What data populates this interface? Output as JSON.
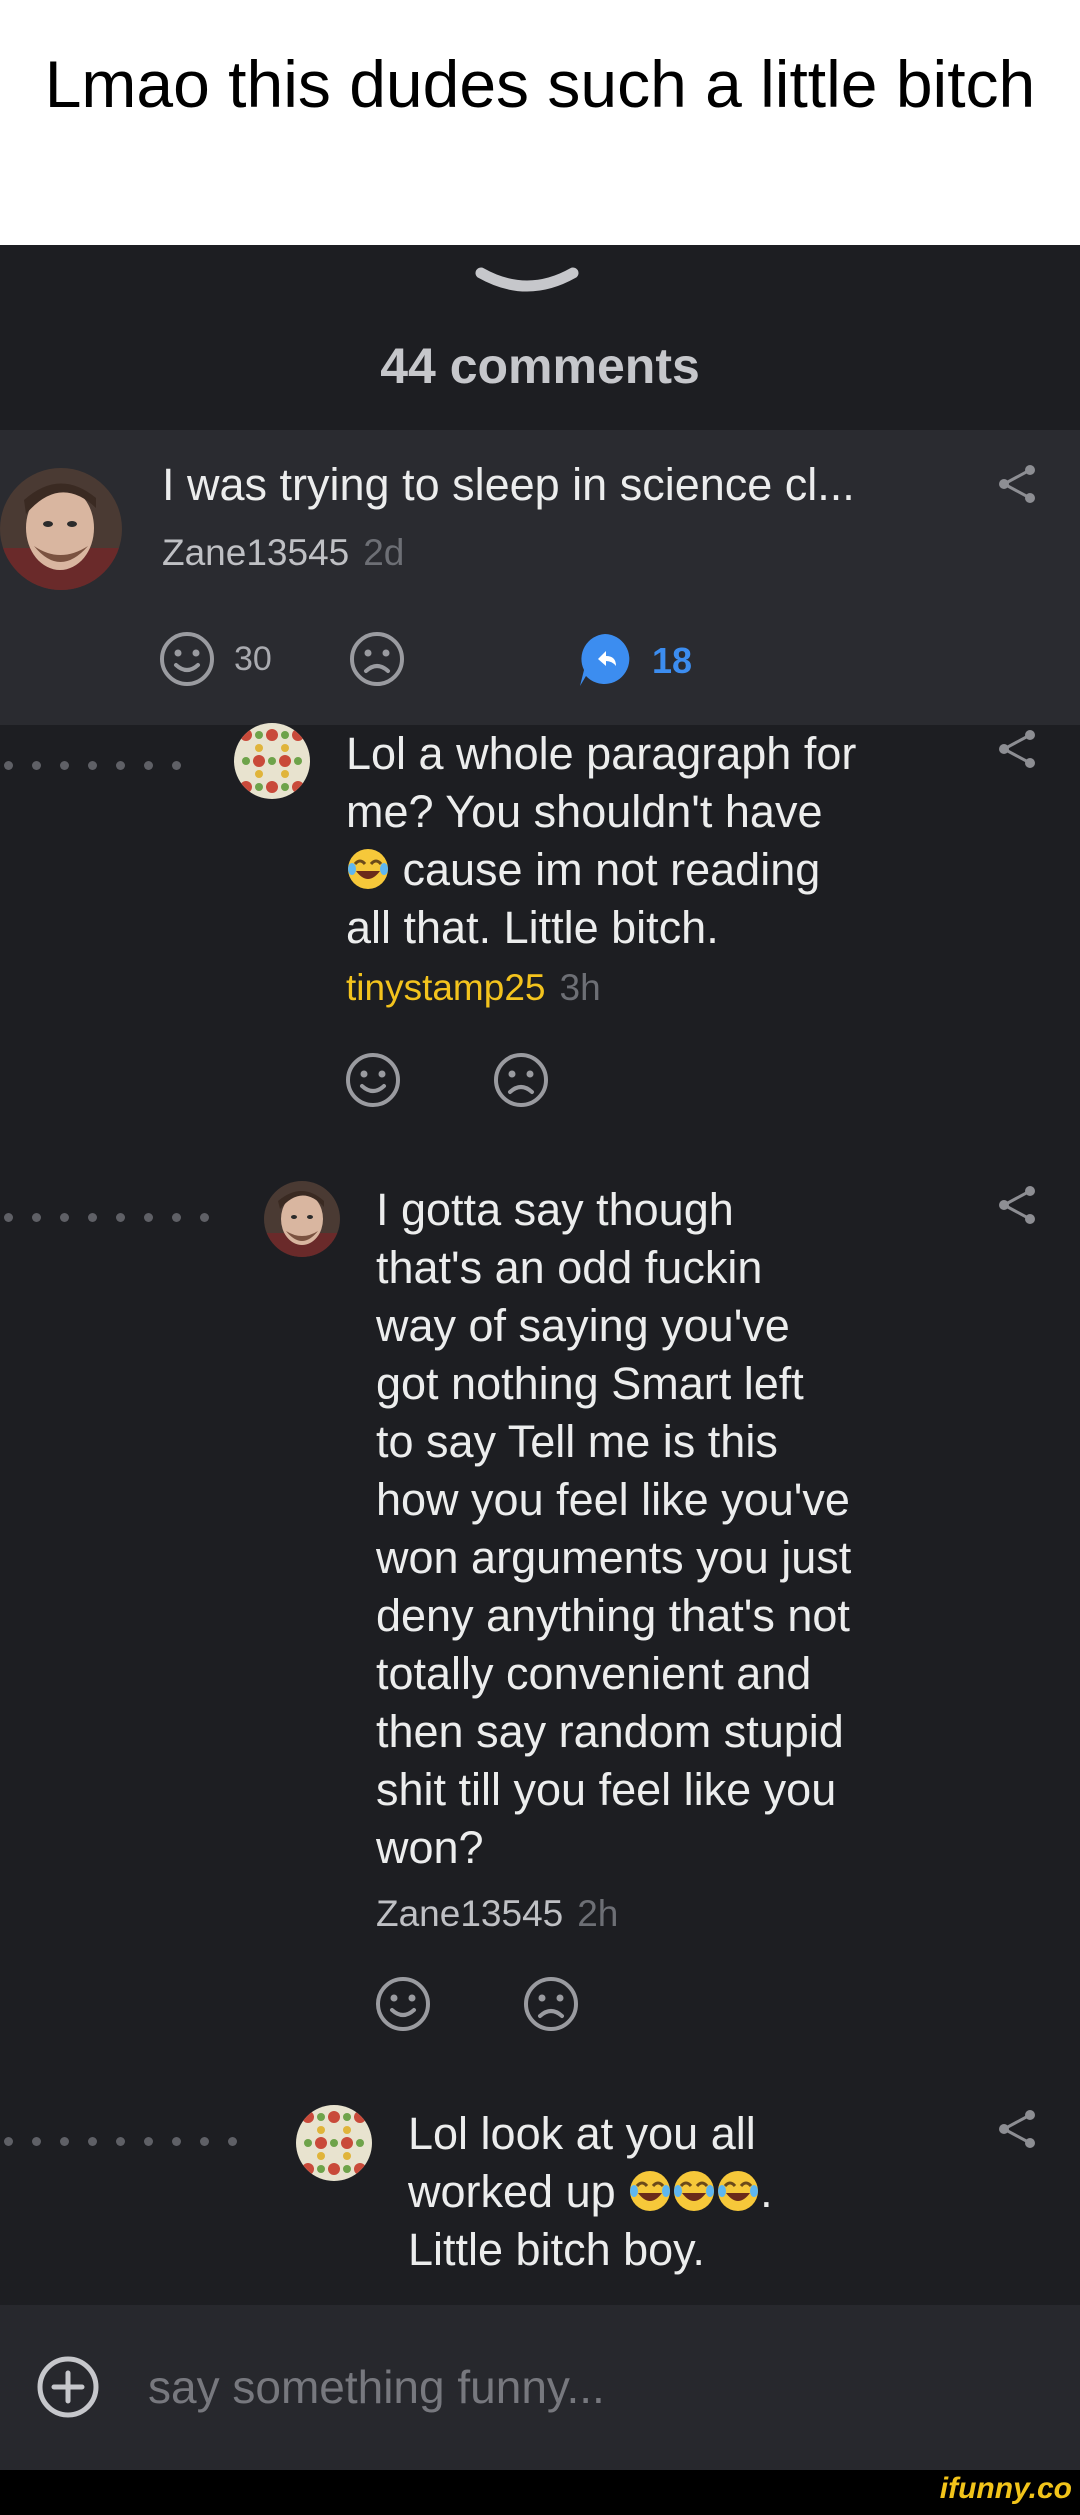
{
  "caption": "Lmao this dudes such a little bitch",
  "header": {
    "title": "44 comments",
    "handle_icon": "chevron-down-icon"
  },
  "root_comment": {
    "text": "I was trying to sleep in science cl...",
    "user": "Zane13545",
    "time": "2d",
    "likes": "30",
    "replies": "18"
  },
  "replies": [
    {
      "line1": "Lol a whole paragraph for",
      "line2": "me? You shouldn't have",
      "line3": " cause im not reading",
      "line4": "all that. Little bitch.",
      "user": "tinystamp25",
      "time": "3h"
    },
    {
      "lines": [
        "I gotta say though",
        "that's an odd fuckin",
        "way of saying you've",
        "got nothing Smart left",
        "to say Tell me is this",
        "how you feel like you've",
        "won arguments you just",
        "deny anything that's not",
        "totally convenient and",
        "then say random stupid",
        "shit till you feel like you",
        "won?"
      ],
      "user": "Zane13545",
      "time": "2h"
    },
    {
      "line1": "Lol look at you all",
      "line2a": "worked up ",
      "line2b": ".",
      "line3": "Little bitch boy."
    }
  ],
  "input": {
    "placeholder": "say something funny..."
  },
  "footer": {
    "logo": "ifunny.co"
  },
  "colors": {
    "background": "#1d1e22",
    "username_highlight": "#f3c31d",
    "reply_accent": "#3c8df0"
  }
}
